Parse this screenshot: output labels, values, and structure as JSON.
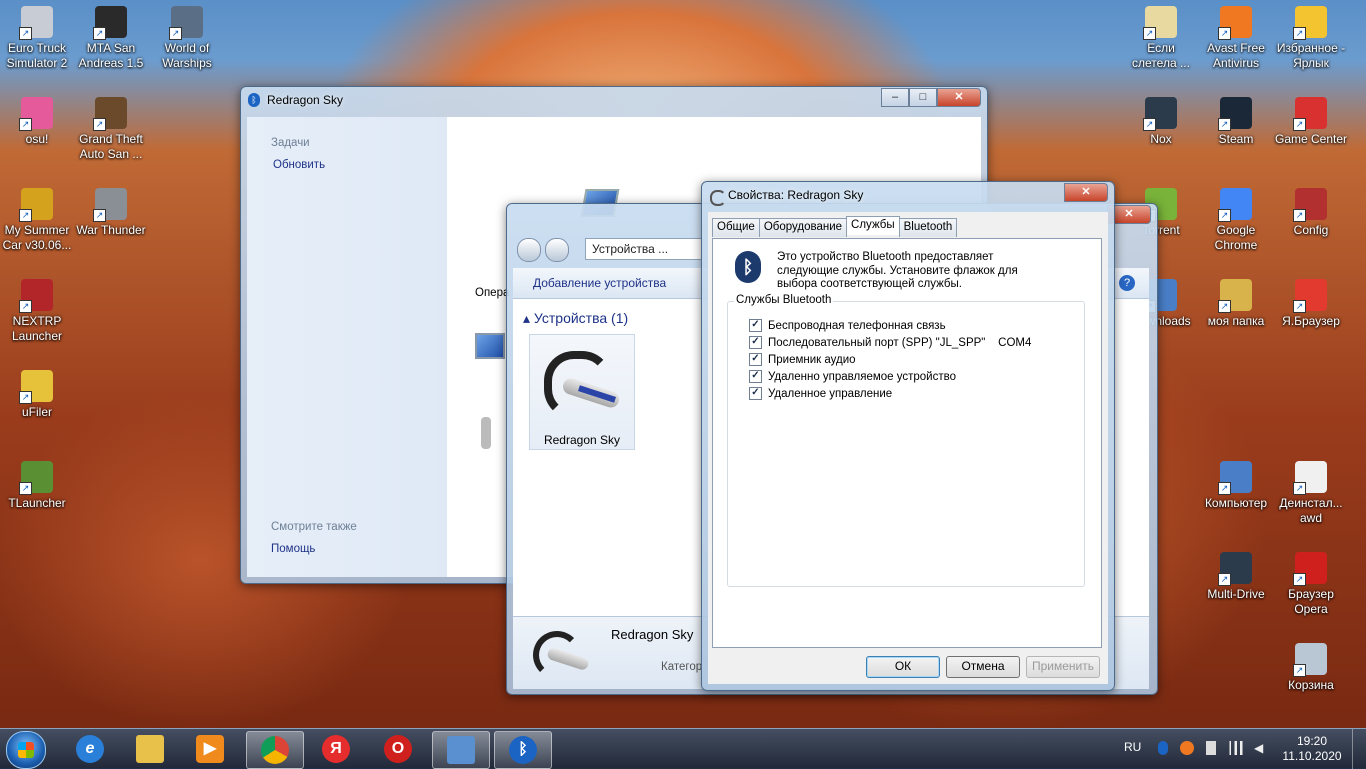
{
  "desktop_left": [
    {
      "label": "Euro Truck Simulator 2",
      "color": "#c8ccd4"
    },
    {
      "label": "MTA San Andreas 1.5",
      "color": "#2a2a2a"
    },
    {
      "label": "World of Warships",
      "color": "#5a6f86"
    },
    {
      "label": "osu!",
      "color": "#e55a9a"
    },
    {
      "label": "Grand Theft Auto San ...",
      "color": "#6a4a2a"
    },
    {
      "label": "My Summer Car v30.06...",
      "color": "#d4a21c"
    },
    {
      "label": "War Thunder",
      "color": "#8a8f96"
    },
    {
      "label": "NEXTRP Launcher",
      "color": "#b2262a"
    },
    {
      "label": "uFiler",
      "color": "#e6c23a"
    },
    {
      "label": "TLauncher",
      "color": "#5b8f33"
    }
  ],
  "desktop_right": [
    {
      "label": "Если слетела ...",
      "color": "#e8d9a0"
    },
    {
      "label": "Avast Free Antivirus",
      "color": "#f07820"
    },
    {
      "label": "Избранное - Ярлык",
      "color": "#f4c430"
    },
    {
      "label": "Nox",
      "color": "#2b3b4c"
    },
    {
      "label": "Steam",
      "color": "#1b2838"
    },
    {
      "label": "Game Center",
      "color": "#d93030"
    },
    {
      "label": "Torrent",
      "color": "#79b33a"
    },
    {
      "label": "Google Chrome",
      "color": "#4285f4"
    },
    {
      "label": "Config",
      "color": "#b23030"
    },
    {
      "label": "Downloads",
      "color": "#4a7fc8"
    },
    {
      "label": "моя папка",
      "color": "#d8b24a"
    },
    {
      "label": "Я.Браузер",
      "color": "#e23a2f"
    },
    {
      "label": "Компьютер",
      "color": "#4a7fc8"
    },
    {
      "label": "Деинстал... awd",
      "color": "#f0f0f0"
    },
    {
      "label": "Multi-Drive",
      "color": "#2b3b4c"
    },
    {
      "label": "Браузер Opera",
      "color": "#d0201e"
    },
    {
      "label": "Корзина",
      "color": "#b9c6d4"
    }
  ],
  "win_back": {
    "title": "Redragon Sky",
    "tasks_header": "Задачи",
    "refresh": "Обновить",
    "see_also": "Смотрите также",
    "help": "Помощь",
    "ops_partial": "Опера"
  },
  "win_devices": {
    "address": "Устройства ...",
    "add_device": "Добавление устройства",
    "group": "Устройства (1)",
    "device_name": "Redragon Sky",
    "detail_name": "Redragon Sky",
    "detail_category": "Категор"
  },
  "dialog": {
    "title": "Свойства: Redragon Sky",
    "tabs": [
      "Общие",
      "Оборудование",
      "Службы",
      "Bluetooth"
    ],
    "description": "Это устройство Bluetooth предоставляет следующие службы. Установите флажок для выбора соответствующей службы.",
    "group_label": "Службы Bluetooth",
    "services": [
      {
        "label": "Беспроводная телефонная связь",
        "checked": true
      },
      {
        "label": "Последовательный порт (SPP) \"JL_SPP\"    COM4",
        "checked": true
      },
      {
        "label": "Приемник аудио",
        "checked": true
      },
      {
        "label": "Удаленно управляемое устройство",
        "checked": true
      },
      {
        "label": "Удаленное управление",
        "checked": true
      }
    ],
    "ok": "ОК",
    "cancel": "Отмена",
    "apply": "Применить"
  },
  "taskbar": {
    "lang": "RU",
    "time": "19:20",
    "date": "11.10.2020"
  }
}
